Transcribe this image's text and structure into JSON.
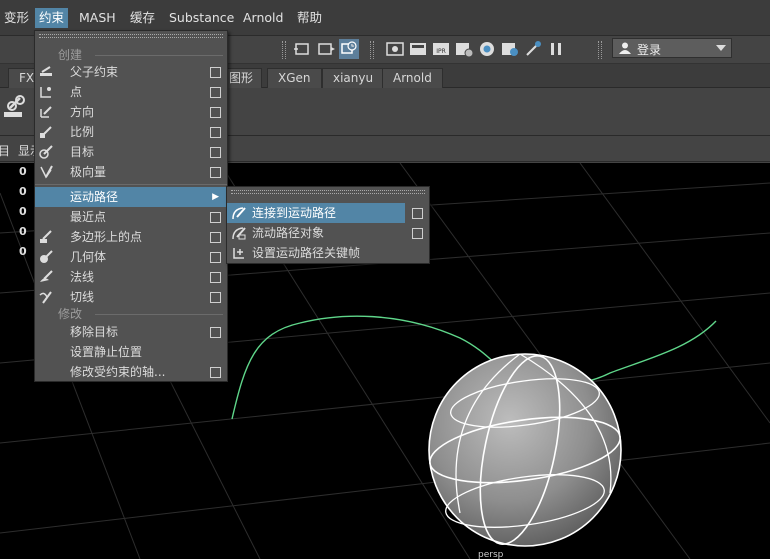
{
  "menubar": {
    "items": [
      {
        "label": "变形"
      },
      {
        "label": "约束"
      },
      {
        "label": "MASH"
      },
      {
        "label": "缓存"
      },
      {
        "label": "Substance"
      },
      {
        "label": "Arnold"
      },
      {
        "label": "帮助"
      }
    ]
  },
  "status_line": {
    "login_label": "登录"
  },
  "shelf_tabs": [
    {
      "label": "FX"
    },
    {
      "label": "图形"
    },
    {
      "label": "XGen"
    },
    {
      "label": "xianyu"
    },
    {
      "label": "Arnold"
    }
  ],
  "panel_menu": {
    "items": [
      {
        "label": "目"
      },
      {
        "label": "显示"
      }
    ]
  },
  "viewport": {
    "channel_values": [
      "0",
      "0",
      "0",
      "0",
      "0"
    ],
    "bottom_label": "persp"
  },
  "constrain_menu": {
    "section_create": "创建",
    "items": [
      {
        "label": "父子约束",
        "icon": "parent-constraint-icon"
      },
      {
        "label": "点",
        "icon": "point-constraint-icon"
      },
      {
        "label": "方向",
        "icon": "orient-constraint-icon"
      },
      {
        "label": "比例",
        "icon": "scale-constraint-icon"
      },
      {
        "label": "目标",
        "icon": "aim-constraint-icon"
      },
      {
        "label": "极向量",
        "icon": "pole-vector-icon"
      }
    ],
    "motion_path": "运动路径",
    "items2": [
      {
        "label": "最近点",
        "icon": ""
      },
      {
        "label": "多边形上的点",
        "icon": "point-on-poly-icon"
      },
      {
        "label": "几何体",
        "icon": "geometry-constraint-icon"
      },
      {
        "label": "法线",
        "icon": "normal-constraint-icon"
      },
      {
        "label": "切线",
        "icon": "tangent-constraint-icon"
      }
    ],
    "section_modify": "修改",
    "items3": [
      {
        "label": "移除目标"
      },
      {
        "label": "设置静止位置"
      },
      {
        "label": "修改受约束的轴..."
      }
    ]
  },
  "motion_path_submenu": {
    "items": [
      {
        "label": "连接到运动路径",
        "icon": "attach-to-motion-path-icon"
      },
      {
        "label": "流动路径对象",
        "icon": "flow-path-object-icon"
      },
      {
        "label": "设置运动路径关键帧",
        "icon": "set-motion-path-key-icon"
      }
    ]
  },
  "colors": {
    "highlight": "#5285a6",
    "curve": "#5fd68a",
    "menu_bg": "#525252"
  }
}
